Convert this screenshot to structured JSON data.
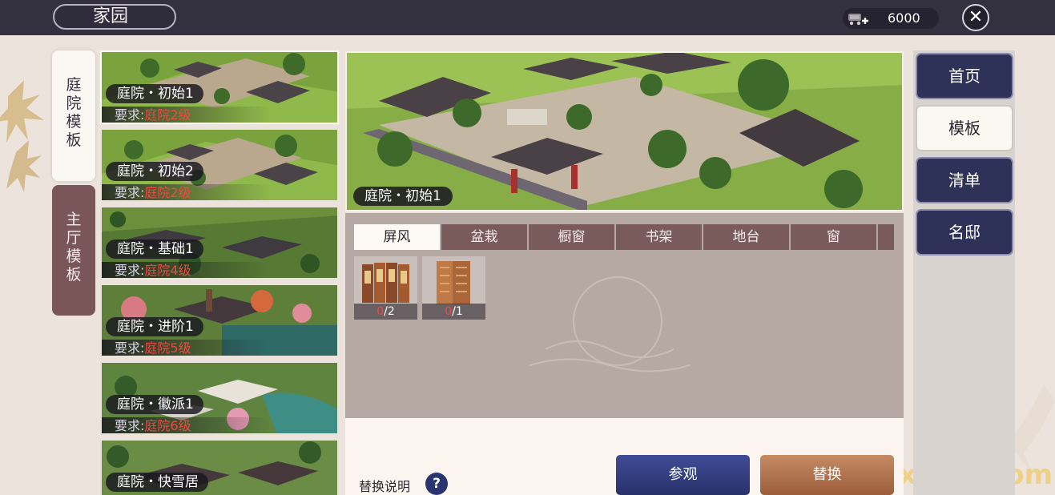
{
  "header": {
    "title": "家园",
    "currency_value": "6000",
    "currency_icon": "cart-coin-icon",
    "close_icon": "close-icon"
  },
  "side_tabs": [
    {
      "label": "庭院模板",
      "active": true
    },
    {
      "label": "主厅模板",
      "active": false
    }
  ],
  "templates": [
    {
      "name": "庭院・初始1",
      "req_label": "要求:",
      "req_level": "庭院2级",
      "selected": true
    },
    {
      "name": "庭院・初始2",
      "req_label": "要求:",
      "req_level": "庭院2级",
      "selected": false
    },
    {
      "name": "庭院・基础1",
      "req_label": "要求:",
      "req_level": "庭院4级",
      "selected": false
    },
    {
      "name": "庭院・进阶1",
      "req_label": "要求:",
      "req_level": "庭院5级",
      "selected": false
    },
    {
      "name": "庭院・徽派1",
      "req_label": "要求:",
      "req_level": "庭院6级",
      "selected": false
    },
    {
      "name": "庭院・快雪居",
      "req_label": "",
      "req_level": "",
      "selected": false
    }
  ],
  "preview": {
    "name": "庭院・初始1"
  },
  "categories": [
    {
      "label": "屏风",
      "active": true
    },
    {
      "label": "盆栽",
      "active": false
    },
    {
      "label": "橱窗",
      "active": false
    },
    {
      "label": "书架",
      "active": false
    },
    {
      "label": "地台",
      "active": false
    },
    {
      "label": "窗",
      "active": false
    }
  ],
  "items": [
    {
      "icon": "folding-screen-icon",
      "have": "0",
      "need": "/2"
    },
    {
      "icon": "wooden-screen-icon",
      "have": "0",
      "need": "/1"
    }
  ],
  "help": {
    "label": "替换说明",
    "icon": "?"
  },
  "actions": {
    "visit": "参观",
    "replace": "替换"
  },
  "nav": [
    {
      "label": "首页",
      "active": false
    },
    {
      "label": "模板",
      "active": true
    },
    {
      "label": "清单",
      "active": false
    },
    {
      "label": "名邸",
      "active": false
    }
  ],
  "watermark": "yxwoo.com",
  "colors": {
    "accent_red": "#ef4a45",
    "nav_blue": "#2f3258",
    "tab_brown": "#795b5b"
  }
}
